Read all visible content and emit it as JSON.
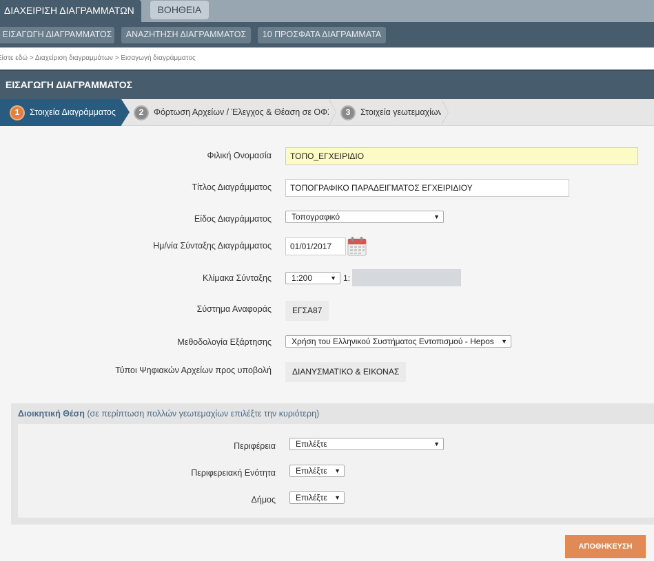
{
  "top_nav": {
    "active_tab": "ΔΙΑΧΕΙΡΙΣΗ ΔΙΑΓΡΑΜΜΑΤΩΝ",
    "help_tab": "ΒΟΗΘΕΙΑ"
  },
  "sub_nav": [
    "ΕΙΣΑΓΩΓΗ ΔΙΑΓΡΑΜΜΑΤΟΣ",
    "ΑΝΑΖΗΤΗΣΗ ΔΙΑΓΡΑΜΜΑΤΟΣ",
    "10 ΠΡΟΣΦΑΤΑ ΔΙΑΓΡΑΜΜΑΤΑ"
  ],
  "breadcrumb": "Είστε εδώ > Διαχείριση διαγραμμάτων > Εισαγωγή διαγράμματος",
  "section_title": "ΕΙΣΑΓΩΓΗ ΔΙΑΓΡΑΜΜΑΤΟΣ",
  "steps": [
    {
      "num": "1",
      "label": "Στοιχεία Διαγράμματος"
    },
    {
      "num": "2",
      "label": "Φόρτωση Αρχείων / Έλεγχος & Θέαση σε ΟΦΧ"
    },
    {
      "num": "3",
      "label": "Στοιχεία γεωτεμαχίων"
    }
  ],
  "form": {
    "friendly_name_label": "Φιλική Ονομασία",
    "friendly_name_value": "ΤΟΠΟ_ΕΓΧΕΙΡΙΔΙΟ",
    "title_label": "Τίτλος Διαγράμματος",
    "title_value": "ΤΟΠΟΓΡΑΦΙΚΟ ΠΑΡΑΔΕΙΓΜΑΤΟΣ ΕΓΧΕΙΡΙΔΙΟΥ",
    "type_label": "Είδος Διαγράμματος",
    "type_value": "Τοπογραφικό",
    "date_label": "Ημ/νία Σύνταξης Διαγράμματος",
    "date_value": "01/01/2017",
    "scale_label": "Κλίμακα Σύνταξης",
    "scale_value": "1:200",
    "scale_prefix": "1:",
    "crs_label": "Σύστημα Αναφοράς",
    "crs_value": "ΕΓΣΑ87",
    "method_label": "Μεθοδολογία Εξάρτησης",
    "method_value": "Χρήση του Ελληνικού Συστήματος Εντοπισμού - Hepos",
    "filetypes_label": "Τύποι Ψηφιακών Αρχείων προς υποβολή",
    "filetypes_value": "ΔΙΑΝΥΣΜΑΤΙΚΟ & ΕΙΚΟΝΑΣ"
  },
  "admin": {
    "heading_bold": "Διοικητική Θέση",
    "heading_note": "(σε περίπτωση πολλών γεωτεμαχίων επιλέξτε την κυριότερη)",
    "region_label": "Περιφέρεια",
    "region_value": "Επιλέξτε",
    "unit_label": "Περιφερειακή Ενότητα",
    "unit_value": "Επιλέξτε",
    "municipality_label": "Δήμος",
    "municipality_value": "Επιλέξτε"
  },
  "save_button": "ΑΠΟΘΗΚΕΥΣΗ",
  "colors": {
    "header_dark": "#475c6c",
    "active_step": "#285b7e",
    "accent_orange": "#e28a56",
    "highlight_input": "#fcfbc6"
  }
}
